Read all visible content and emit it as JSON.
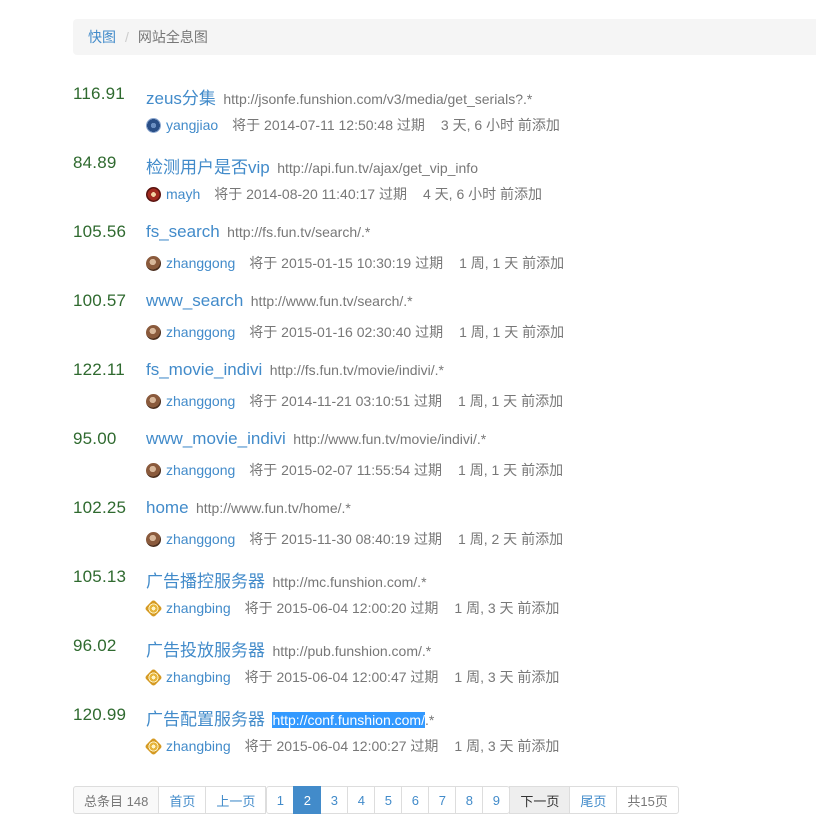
{
  "breadcrumb": {
    "home": "快图",
    "separator": "/",
    "current": "网站全息图"
  },
  "items": [
    {
      "score": "116.91",
      "name": "zeus分集",
      "url": "http://jsonfe.funshion.com/v3/media/get_serials?.*",
      "user": "yangjiao",
      "avatar": "yangjiao",
      "expire": "将于 2014-07-11 12:50:48 过期",
      "added": "3 天, 6 小时 前添加"
    },
    {
      "score": "84.89",
      "name": "检测用户是否vip",
      "url": "http://api.fun.tv/ajax/get_vip_info",
      "user": "mayh",
      "avatar": "mayh",
      "expire": "将于 2014-08-20 11:40:17 过期",
      "added": "4 天, 6 小时 前添加"
    },
    {
      "score": "105.56",
      "name": "fs_search",
      "url": "http://fs.fun.tv/search/.*",
      "user": "zhanggong",
      "avatar": "zhanggong",
      "expire": "将于 2015-01-15 10:30:19 过期",
      "added": "1 周, 1 天 前添加"
    },
    {
      "score": "100.57",
      "name": "www_search",
      "url": "http://www.fun.tv/search/.*",
      "user": "zhanggong",
      "avatar": "zhanggong",
      "expire": "将于 2015-01-16 02:30:40 过期",
      "added": "1 周, 1 天 前添加"
    },
    {
      "score": "122.11",
      "name": "fs_movie_indivi",
      "url": "http://fs.fun.tv/movie/indivi/.*",
      "user": "zhanggong",
      "avatar": "zhanggong",
      "expire": "将于 2014-11-21 03:10:51 过期",
      "added": "1 周, 1 天 前添加"
    },
    {
      "score": "95.00",
      "name": "www_movie_indivi",
      "url": "http://www.fun.tv/movie/indivi/.*",
      "user": "zhanggong",
      "avatar": "zhanggong",
      "expire": "将于 2015-02-07 11:55:54 过期",
      "added": "1 周, 1 天 前添加"
    },
    {
      "score": "102.25",
      "name": "home",
      "url": "http://www.fun.tv/home/.*",
      "user": "zhanggong",
      "avatar": "zhanggong",
      "expire": "将于 2015-11-30 08:40:19 过期",
      "added": "1 周, 2 天 前添加"
    },
    {
      "score": "105.13",
      "name": "广告播控服务器",
      "url": "http://mc.funshion.com/.*",
      "user": "zhangbing",
      "avatar": "zhangbing",
      "expire": "将于 2015-06-04 12:00:20 过期",
      "added": "1 周, 3 天 前添加"
    },
    {
      "score": "96.02",
      "name": "广告投放服务器",
      "url": "http://pub.funshion.com/.*",
      "user": "zhangbing",
      "avatar": "zhangbing",
      "expire": "将于 2015-06-04 12:00:47 过期",
      "added": "1 周, 3 天 前添加"
    },
    {
      "score": "120.99",
      "name": "广告配置服务器",
      "url": "http://conf.funshion.com/.*",
      "url_selected": "http://conf.funshion.com/",
      "url_rest": ".*",
      "user": "zhangbing",
      "avatar": "zhangbing",
      "expire": "将于 2015-06-04 12:00:27 过期",
      "added": "1 周, 3 天 前添加"
    }
  ],
  "pagination": {
    "total": "总条目 148",
    "first": "首页",
    "prev": "上一页",
    "pages": [
      "1",
      "2",
      "3",
      "4",
      "5",
      "6",
      "7",
      "8",
      "9"
    ],
    "current": "2",
    "next": "下一页",
    "last": "尾页",
    "page_count": "共15页"
  }
}
